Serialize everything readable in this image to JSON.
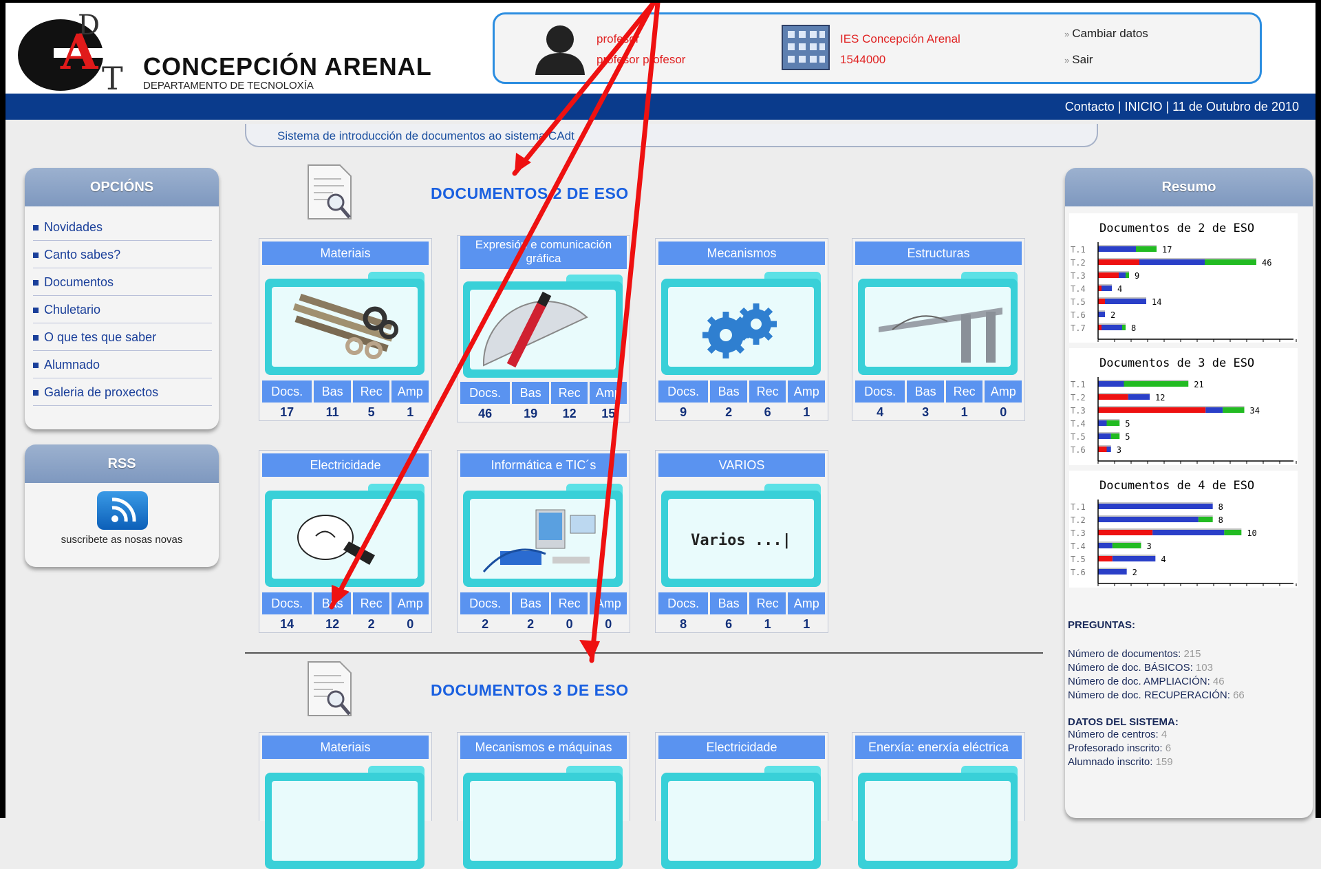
{
  "header": {
    "site_title": "CONCEPCIÓN  ARENAL",
    "site_subtitle": "DEPARTAMENTO DE TECNOLOXÍA",
    "logo_letters": "DAT",
    "user": {
      "name": "profesor",
      "fullname": "profesor profesor"
    },
    "school": {
      "name": "IES Concepción Arenal",
      "code": "1544000"
    },
    "links": {
      "change": "Cambiar datos",
      "exit": "Sair"
    },
    "nav": {
      "contact": "Contacto",
      "home": "INICIO",
      "date": "11 de Outubro de 2010"
    },
    "tagline": "Sistema de introducción de documentos ao sistema CAdt"
  },
  "sidebar": {
    "title": "OPCIÓNS",
    "items": [
      {
        "label": "Novidades"
      },
      {
        "label": "Canto sabes?"
      },
      {
        "label": "Documentos"
      },
      {
        "label": "Chuletario"
      },
      {
        "label": "O que tes que saber"
      },
      {
        "label": "Alumnado"
      },
      {
        "label": "Galeria de proxectos"
      }
    ],
    "rss": {
      "title": "RSS",
      "caption": "suscribete as nosas novas"
    }
  },
  "count_headers": [
    "Docs.",
    "Bas",
    "Rec",
    "Amp"
  ],
  "sections": [
    {
      "title": "DOCUMENTOS 2 DE ESO",
      "cards": [
        {
          "title": "Materiais",
          "values": [
            "17",
            "11",
            "5",
            "1"
          ]
        },
        {
          "title": "Expresión e comunicación gráfica",
          "values": [
            "46",
            "19",
            "12",
            "15"
          ]
        },
        {
          "title": "Mecanismos",
          "values": [
            "9",
            "2",
            "6",
            "1"
          ]
        },
        {
          "title": "Estructuras",
          "values": [
            "4",
            "3",
            "1",
            "0"
          ]
        },
        {
          "title": "Electricidade",
          "values": [
            "14",
            "12",
            "2",
            "0"
          ]
        },
        {
          "title": "Informática e TIC´s",
          "values": [
            "2",
            "2",
            "0",
            "0"
          ]
        },
        {
          "title": "VARIOS",
          "values": [
            "8",
            "6",
            "1",
            "1"
          ],
          "caption": "Varios ...|"
        }
      ]
    },
    {
      "title": "DOCUMENTOS 3 DE ESO",
      "cards": [
        {
          "title": "Materiais"
        },
        {
          "title": "Mecanismos e máquinas"
        },
        {
          "title": "Electricidade"
        },
        {
          "title": "Enerxía: enerxía eléctrica"
        }
      ]
    }
  ],
  "resumo": {
    "title": "Resumo",
    "colors": {
      "red": "#ee1111",
      "blue": "#2a3fc8",
      "green": "#22bb22"
    },
    "charts": [
      {
        "title": "Documentos de 2 de ESO",
        "rows": [
          {
            "label": "T.1",
            "total": 17,
            "red": 0,
            "blue": 11,
            "green": 6
          },
          {
            "label": "T.2",
            "total": 46,
            "red": 12,
            "blue": 19,
            "green": 15
          },
          {
            "label": "T.3",
            "total": 9,
            "red": 6,
            "blue": 2,
            "green": 1
          },
          {
            "label": "T.4",
            "total": 4,
            "red": 1,
            "blue": 3,
            "green": 0
          },
          {
            "label": "T.5",
            "total": 14,
            "red": 2,
            "blue": 12,
            "green": 0
          },
          {
            "label": "T.6",
            "total": 2,
            "red": 0,
            "blue": 2,
            "green": 0
          },
          {
            "label": "T.7",
            "total": 8,
            "red": 1,
            "blue": 6,
            "green": 1
          }
        ],
        "max": 50
      },
      {
        "title": "Documentos de 3 de ESO",
        "rows": [
          {
            "label": "T.1",
            "total": 21,
            "red": 0,
            "blue": 6,
            "green": 15
          },
          {
            "label": "T.2",
            "total": 12,
            "red": 7,
            "blue": 5,
            "green": 0
          },
          {
            "label": "T.3",
            "total": 34,
            "red": 25,
            "blue": 4,
            "green": 5
          },
          {
            "label": "T.4",
            "total": 5,
            "red": 0,
            "blue": 2,
            "green": 3
          },
          {
            "label": "T.5",
            "total": 5,
            "red": 0,
            "blue": 3,
            "green": 2
          },
          {
            "label": "T.6",
            "total": 3,
            "red": 2,
            "blue": 1,
            "green": 0
          }
        ],
        "max": 40
      },
      {
        "title": "Documentos de 4 de ESO",
        "rows": [
          {
            "label": "T.1",
            "total": 8,
            "red": 0,
            "blue": 8,
            "green": 0
          },
          {
            "label": "T.2",
            "total": 8,
            "red": 0,
            "blue": 7,
            "green": 1
          },
          {
            "label": "T.3",
            "total": 10,
            "red": 3.8,
            "blue": 5,
            "green": 1.2
          },
          {
            "label": "T.4",
            "total": 3,
            "red": 0,
            "blue": 1,
            "green": 2
          },
          {
            "label": "T.5",
            "total": 4,
            "red": 1,
            "blue": 3,
            "green": 0
          },
          {
            "label": "T.6",
            "total": 2,
            "red": 0,
            "blue": 2,
            "green": 0
          }
        ],
        "max": 12
      }
    ],
    "preguntas_title": "PREGUNTAS:",
    "stats": [
      {
        "label": "Número de documentos:",
        "value": "215"
      },
      {
        "label": "Número de doc. BÁSICOS:",
        "value": "103"
      },
      {
        "label": "Número de doc. AMPLIACIÓN:",
        "value": "46"
      },
      {
        "label": "Número de doc. RECUPERACIÓN:",
        "value": "66"
      }
    ],
    "system_title": "DATOS DEL SISTEMA:",
    "system": [
      {
        "label": "Número de centros:",
        "value": "4"
      },
      {
        "label": "Profesorado inscrito:",
        "value": "6"
      },
      {
        "label": "Alumnado inscrito:",
        "value": "159"
      }
    ]
  }
}
